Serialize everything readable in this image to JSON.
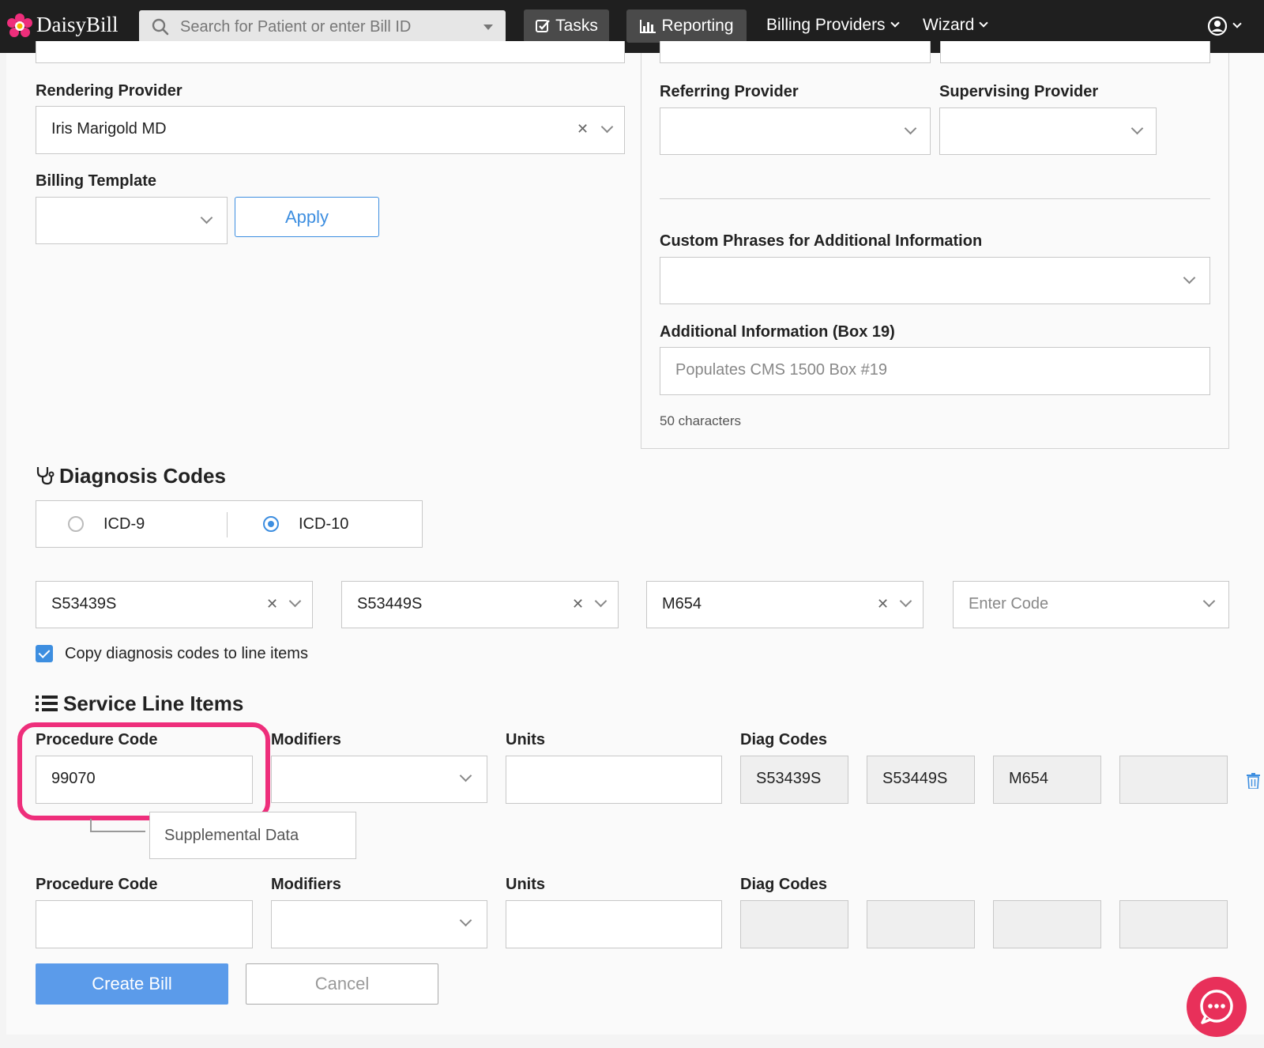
{
  "nav": {
    "brand": "DaisyBill",
    "search_placeholder": "Search for Patient or enter Bill ID",
    "tasks": "Tasks",
    "reporting": "Reporting",
    "billing_providers": "Billing Providers",
    "wizard": "Wizard"
  },
  "left": {
    "rendering_provider_label": "Rendering Provider",
    "rendering_provider_value": "Iris Marigold MD",
    "billing_template_label": "Billing Template",
    "apply": "Apply"
  },
  "right": {
    "referring_provider_label": "Referring Provider",
    "supervising_provider_label": "Supervising Provider",
    "custom_phrases_label": "Custom Phrases for Additional Information",
    "additional_info_label": "Additional Information (Box 19)",
    "additional_info_placeholder": "Populates CMS 1500 Box #19",
    "char_count": "50 characters"
  },
  "diagnosis": {
    "title": "Diagnosis Codes",
    "icd9": "ICD-9",
    "icd10": "ICD-10",
    "selected": "ICD-10",
    "codes": [
      "S53439S",
      "S53449S",
      "M654"
    ],
    "enter_code_placeholder": "Enter Code",
    "copy_label": "Copy diagnosis codes to line items"
  },
  "service": {
    "title": "Service Line Items",
    "procedure_label": "Procedure Code",
    "modifiers_label": "Modifiers",
    "units_label": "Units",
    "diag_label": "Diag Codes",
    "row1": {
      "procedure": "99070",
      "diag": [
        "S53439S",
        "S53449S",
        "M654",
        ""
      ]
    },
    "supplemental": "Supplemental Data"
  },
  "actions": {
    "create": "Create Bill",
    "cancel": "Cancel"
  },
  "colors": {
    "accent": "#3d8ee0",
    "highlight": "#ee2e7b",
    "chat": "#e8305a"
  }
}
